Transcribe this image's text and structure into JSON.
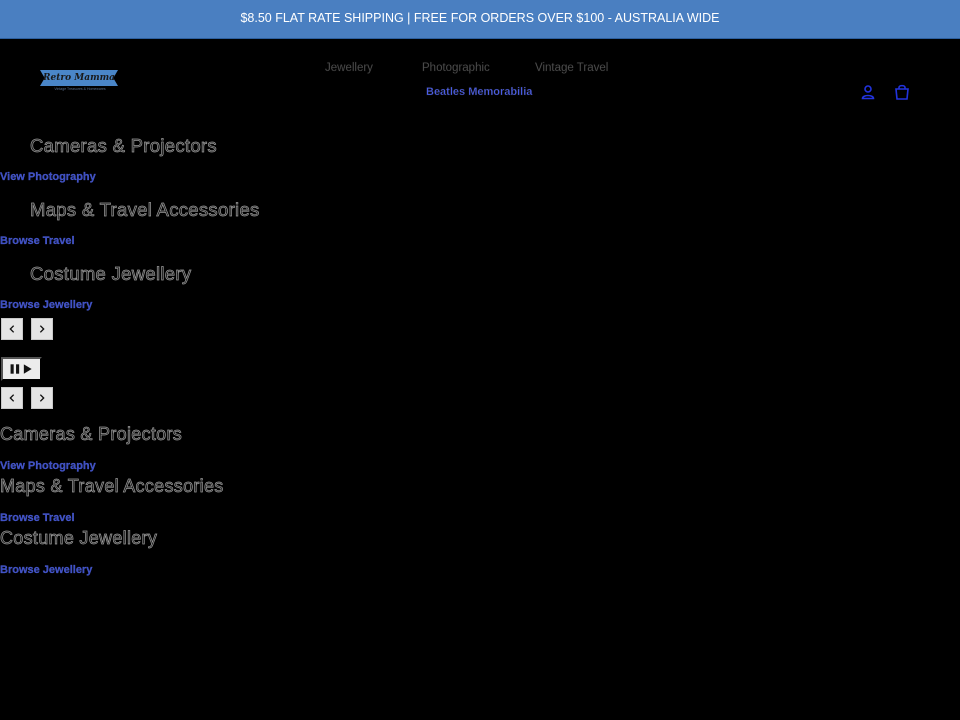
{
  "announcement": {
    "text": "$8.50 FLAT RATE SHIPPING | FREE FOR ORDERS OVER $100 - AUSTRALIA WIDE"
  },
  "logo": {
    "name": "Retro Mamma",
    "tagline": "Vintage Treasures & Homewares"
  },
  "nav": {
    "items": [
      "Jewellery",
      "Photographic",
      "Vintage Travel",
      "Beatles Memorabilia"
    ]
  },
  "header_icons": {
    "account": "account-icon",
    "cart": "cart-icon"
  },
  "slideshow": {
    "slides": [
      {
        "title": "Cameras & Projectors",
        "link": "View Photography"
      },
      {
        "title": "Maps & Travel Accessories",
        "link": "Browse Travel"
      },
      {
        "title": "Costume Jewellery",
        "link": "Browse Jewellery"
      }
    ],
    "controls": {
      "prev": "chevron-left-icon",
      "next": "chevron-right-icon",
      "pause_play": "pause-play-icon"
    }
  },
  "slideshow_mobile": {
    "slides": [
      {
        "title": "Cameras & Projectors",
        "link": "View Photography"
      },
      {
        "title": "Maps & Travel Accessories",
        "link": "Browse Travel"
      },
      {
        "title": "Costume Jewellery",
        "link": "Browse Jewellery"
      }
    ]
  },
  "colors": {
    "announcement_bg": "#4a7fc1",
    "link_blue": "#3d4fc0",
    "page_bg": "#000000"
  }
}
